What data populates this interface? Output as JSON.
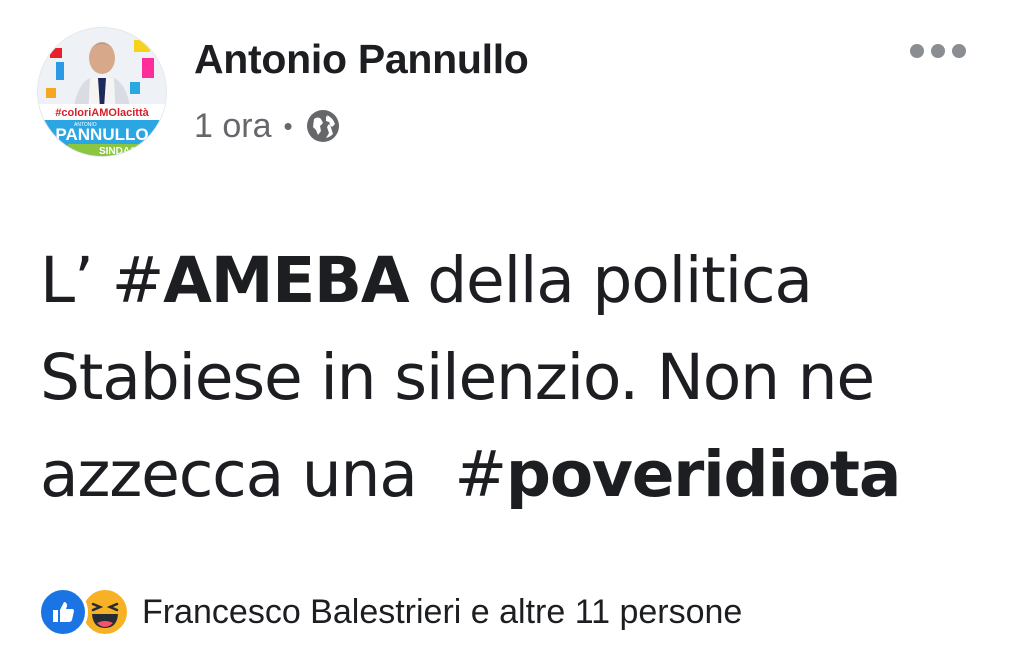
{
  "post": {
    "author": {
      "name": "Antonio Pannullo",
      "avatar_text": {
        "hashtag": "#coloriAMOlacittà",
        "small": "ANTONIO",
        "surname": "PANNULLO",
        "role": "SINDACO"
      }
    },
    "meta": {
      "time": "1 ora",
      "separator": "•",
      "privacy_icon": "globe-icon"
    },
    "options_icon": "more-icon",
    "text": {
      "line1_prefix": "L’ ",
      "line1_hash": "#",
      "line1_tag": "AMEBA",
      "line1_suffix": " della politica",
      "line2": "Stabiese in silenzio. Non ne",
      "line3_prefix": "azzecca una  ",
      "line3_hash": "#",
      "line3_tag": "poveridiota"
    },
    "reactions": {
      "icons": [
        "like-icon",
        "haha-icon"
      ],
      "summary": "Francesco Balestrieri e altre 11 persone"
    }
  },
  "colors": {
    "text": "#1c1e21",
    "secondary_text": "#65676b",
    "like_blue": "#1b74e4",
    "haha_yellow": "#f7b125"
  }
}
